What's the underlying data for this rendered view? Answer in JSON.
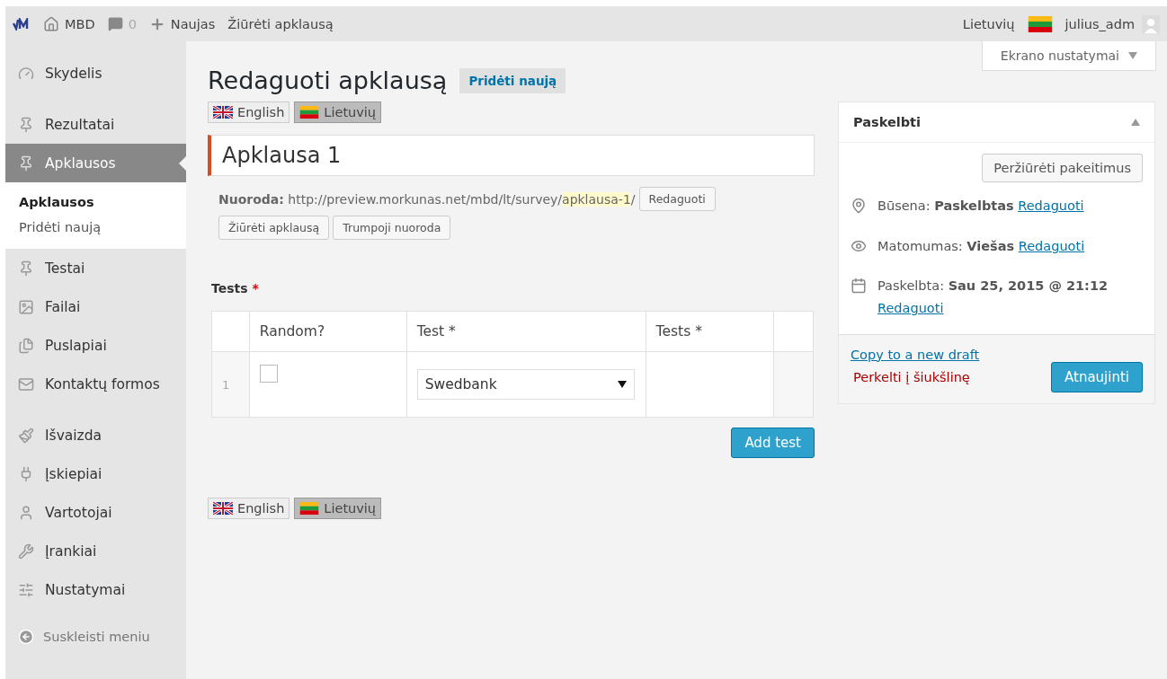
{
  "topbar": {
    "site": "MBD",
    "comments": "0",
    "new": "Naujas",
    "view": "Žiūrėti apklausą",
    "language": "Lietuvių",
    "user": "julius_adm"
  },
  "sidebar": {
    "groups": [
      {
        "items": [
          {
            "label": "Skydelis",
            "selected": false
          }
        ]
      },
      {
        "items": [
          {
            "label": "Rezultatai",
            "selected": false
          },
          {
            "label": "Apklausos",
            "selected": true,
            "children": [
              {
                "label": "Apklausos",
                "selected": true
              },
              {
                "label": "Pridėti naują",
                "selected": false
              }
            ]
          },
          {
            "label": "Testai",
            "selected": false
          },
          {
            "label": "Failai",
            "selected": false
          },
          {
            "label": "Puslapiai",
            "selected": false
          },
          {
            "label": "Kontaktų formos",
            "selected": false
          }
        ]
      },
      {
        "items": [
          {
            "label": "Išvaizda",
            "selected": false
          },
          {
            "label": "Įskiepiai",
            "selected": false
          },
          {
            "label": "Vartotojai",
            "selected": false
          },
          {
            "label": "Įrankiai",
            "selected": false
          },
          {
            "label": "Nustatymai",
            "selected": false
          }
        ]
      }
    ],
    "collapse": "Suskleisti meniu"
  },
  "screen_options": "Ekrano nustatymai",
  "heading": "Redaguoti apklausą",
  "add_new": "Pridėti naują",
  "languages_top": [
    {
      "label": "English",
      "selected": false
    },
    {
      "label": "Lietuvių",
      "selected": true
    }
  ],
  "title_value": "Apklausa 1",
  "permalink": {
    "label": "Nuoroda:",
    "url": "http://preview.morkunas.net/mbd/lt/survey/",
    "slug": "apklausa-1",
    "tail": "/",
    "edit": "Redaguoti",
    "view": "Žiūrėti apklausą",
    "shortlink": "Trumpoji nuoroda"
  },
  "tests": {
    "label": "Tests",
    "required": "*",
    "columns": [
      "Random?",
      "Test *",
      "Tests *"
    ],
    "rows": [
      {
        "number": "1",
        "random_checked": false,
        "test": "Swedbank"
      }
    ],
    "add_button": "Add test"
  },
  "languages_bottom": [
    {
      "label": "English",
      "selected": false
    },
    {
      "label": "Lietuvių",
      "selected": true
    }
  ],
  "publish": {
    "title": "Paskelbti",
    "preview": "Peržiūrėti pakeitimus",
    "rows": [
      {
        "label": "Būsena:",
        "value": "Paskelbtas",
        "link": "Redaguoti"
      },
      {
        "label": "Matomumas:",
        "value": "Viešas",
        "link": "Redaguoti"
      },
      {
        "label": "Paskelbta:",
        "value": "Sau 25, 2015 @ 21:12",
        "link": "Redaguoti"
      }
    ],
    "copy": "Copy to a new draft",
    "trash": "Perkelti į šiukšlinę",
    "update": "Atnaujinti"
  }
}
